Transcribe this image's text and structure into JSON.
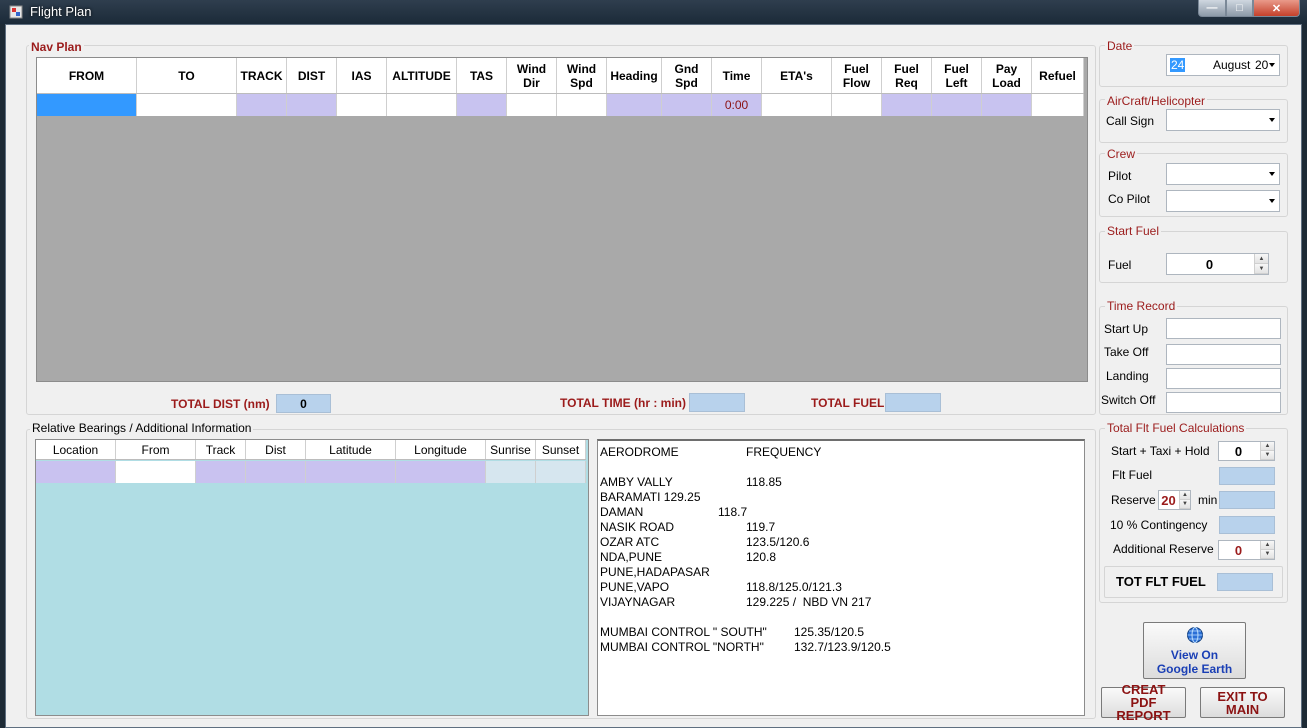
{
  "window": {
    "title": "Flight Plan",
    "min_label": "—",
    "max_label": "□",
    "close_label": "✕"
  },
  "nav_plan": {
    "legend": "Nav Plan",
    "columns": [
      "FROM",
      "TO",
      "TRACK",
      "DIST",
      "IAS",
      "ALTITUDE",
      "TAS",
      "Wind Dir",
      "Wind Spd",
      "Heading",
      "Gnd Spd",
      "Time",
      "ETA's",
      "Fuel Flow",
      "Fuel Req",
      "Fuel Left",
      "Pay Load",
      "Refuel"
    ],
    "row_time_value": "0:00"
  },
  "totals": {
    "dist_label": "TOTAL DIST (nm)",
    "dist_value": "0",
    "time_label": "TOTAL TIME (hr : min)",
    "time_value": "",
    "fuel_label": "TOTAL FUEL",
    "fuel_value": ""
  },
  "relative_bearings": {
    "legend": "Relative Bearings / Additional Information",
    "columns": [
      "Location",
      "From",
      "Track",
      "Dist",
      "Latitude",
      "Longitude",
      "Sunrise",
      "Sunset"
    ]
  },
  "frequencies": {
    "header_left": "AERODROME",
    "header_right": "FREQUENCY",
    "lines": [
      {
        "name": "AMBY VALLY",
        "freq": "118.85"
      },
      {
        "name": "BARAMATI 129.25",
        "freq": ""
      },
      {
        "name": "DAMAN",
        "freq": "118.7"
      },
      {
        "name": "NASIK ROAD",
        "freq": "119.7"
      },
      {
        "name": "OZAR ATC",
        "freq": "123.5/120.6"
      },
      {
        "name": "NDA,PUNE",
        "freq": "120.8"
      },
      {
        "name": "PUNE,HADAPASAR",
        "freq": ""
      },
      {
        "name": "PUNE,VAPO",
        "freq": "118.8/125.0/121.3"
      },
      {
        "name": "VIJAYNAGAR",
        "freq": "129.225 /  NBD VN 217"
      },
      {
        "name": "MUMBAI CONTROL \" SOUTH\"",
        "freq": "125.35/120.5"
      },
      {
        "name": "MUMBAI CONTROL \"NORTH\"",
        "freq": "132.7/123.9/120.5"
      }
    ]
  },
  "date": {
    "legend": "Date",
    "day": "24",
    "month": "August",
    "year": "20"
  },
  "aircraft": {
    "legend": "AirCraft/Helicopter",
    "call_sign_label": "Call Sign",
    "call_sign_value": ""
  },
  "crew": {
    "legend": "Crew",
    "pilot_label": "Pilot",
    "copilot_label": "Co Pilot"
  },
  "start_fuel": {
    "legend": "Start Fuel",
    "fuel_label": "Fuel",
    "fuel_value": "0"
  },
  "time_record": {
    "legend": "Time Record",
    "items": [
      "Start Up",
      "Take Off",
      "Landing",
      "Switch Off"
    ]
  },
  "fuel_calc": {
    "legend": "Total Flt Fuel Calculations",
    "start_taxi_label": "Start + Taxi + Hold",
    "start_taxi_value": "0",
    "flt_fuel_label": "Flt Fuel",
    "reserve_label": "Reserve",
    "reserve_value": "20",
    "reserve_unit": "min",
    "contingency_label": "10 % Contingency",
    "additional_label": "Additional Reserve",
    "additional_value": "0",
    "tot_label": "TOT FLT FUEL"
  },
  "buttons": {
    "google_earth": "View On Google Earth",
    "pdf": "CREAT PDF REPORT",
    "exit": "EXIT TO MAIN"
  },
  "colors": {
    "lavender": "#c8c3f0",
    "selected": "#3399ff",
    "cyan_area": "#b0dde4",
    "grey_area": "#a9a9a9",
    "dark_red": "#9b1b1b",
    "total_box": "#b8d2ec"
  }
}
